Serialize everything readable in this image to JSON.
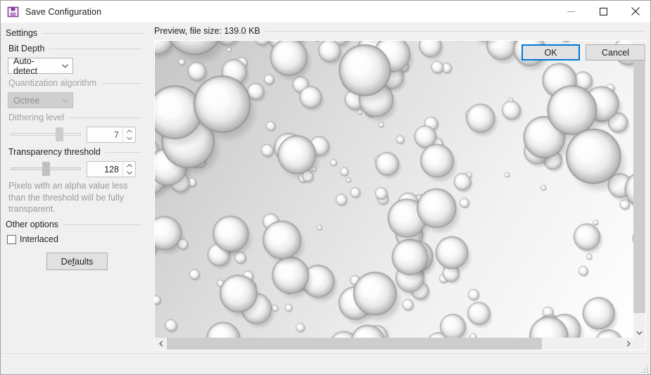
{
  "window": {
    "title": "Save Configuration",
    "icon": "floppy-disk-save-icon",
    "icon_color": "#8a3a9e",
    "minimize_label": "Minimize",
    "maximize_label": "Maximize",
    "close_label": "Close"
  },
  "settings": {
    "group_label": "Settings",
    "bit_depth": {
      "label": "Bit Depth",
      "value": "Auto-detect",
      "enabled": true
    },
    "quantization": {
      "label": "Quantization algorithm",
      "value": "Octree",
      "enabled": false
    },
    "dithering": {
      "label": "Dithering level",
      "value": "7",
      "slider_percent": 72,
      "enabled": false
    },
    "transparency": {
      "label": "Transparency threshold",
      "value": "128",
      "slider_percent": 50,
      "enabled": true
    },
    "help_text": "Pixels with an alpha value less than the threshold will be fully transparent.",
    "other_options": {
      "label": "Other options",
      "interlaced": {
        "label": "Interlaced",
        "checked": false
      }
    },
    "defaults_button": {
      "label_before": "De",
      "label_accel": "f",
      "label_after": "aults"
    }
  },
  "preview": {
    "header": "Preview, file size: 139.0 KB",
    "image_description": "grayscale bubbles and droplets pattern",
    "scroll_up_icon": "chevron-up-icon",
    "scroll_down_icon": "chevron-down-icon",
    "scroll_left_icon": "chevron-left-icon",
    "scroll_right_icon": "chevron-right-icon"
  },
  "footer": {
    "ok_label": "OK",
    "cancel_label": "Cancel",
    "ok_focus_color": "#0078d7"
  }
}
